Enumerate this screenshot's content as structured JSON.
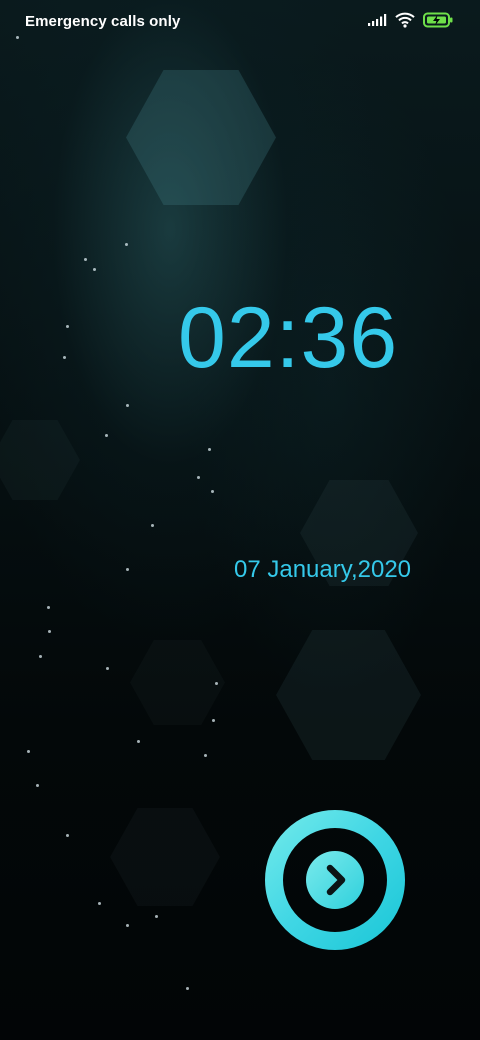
{
  "status_bar": {
    "carrier_text": "Emergency calls only",
    "icons": [
      "signal-icon",
      "wifi-icon",
      "battery-charging-icon"
    ]
  },
  "lockscreen": {
    "time": "02:36",
    "date": "07 January,2020"
  },
  "unlock_button": {
    "icon": "chevron-right-icon"
  },
  "colors": {
    "accent": "#35c9ea",
    "ring_light": "#5fe3ea",
    "battery": "#6fe04a",
    "background": "#020608"
  }
}
